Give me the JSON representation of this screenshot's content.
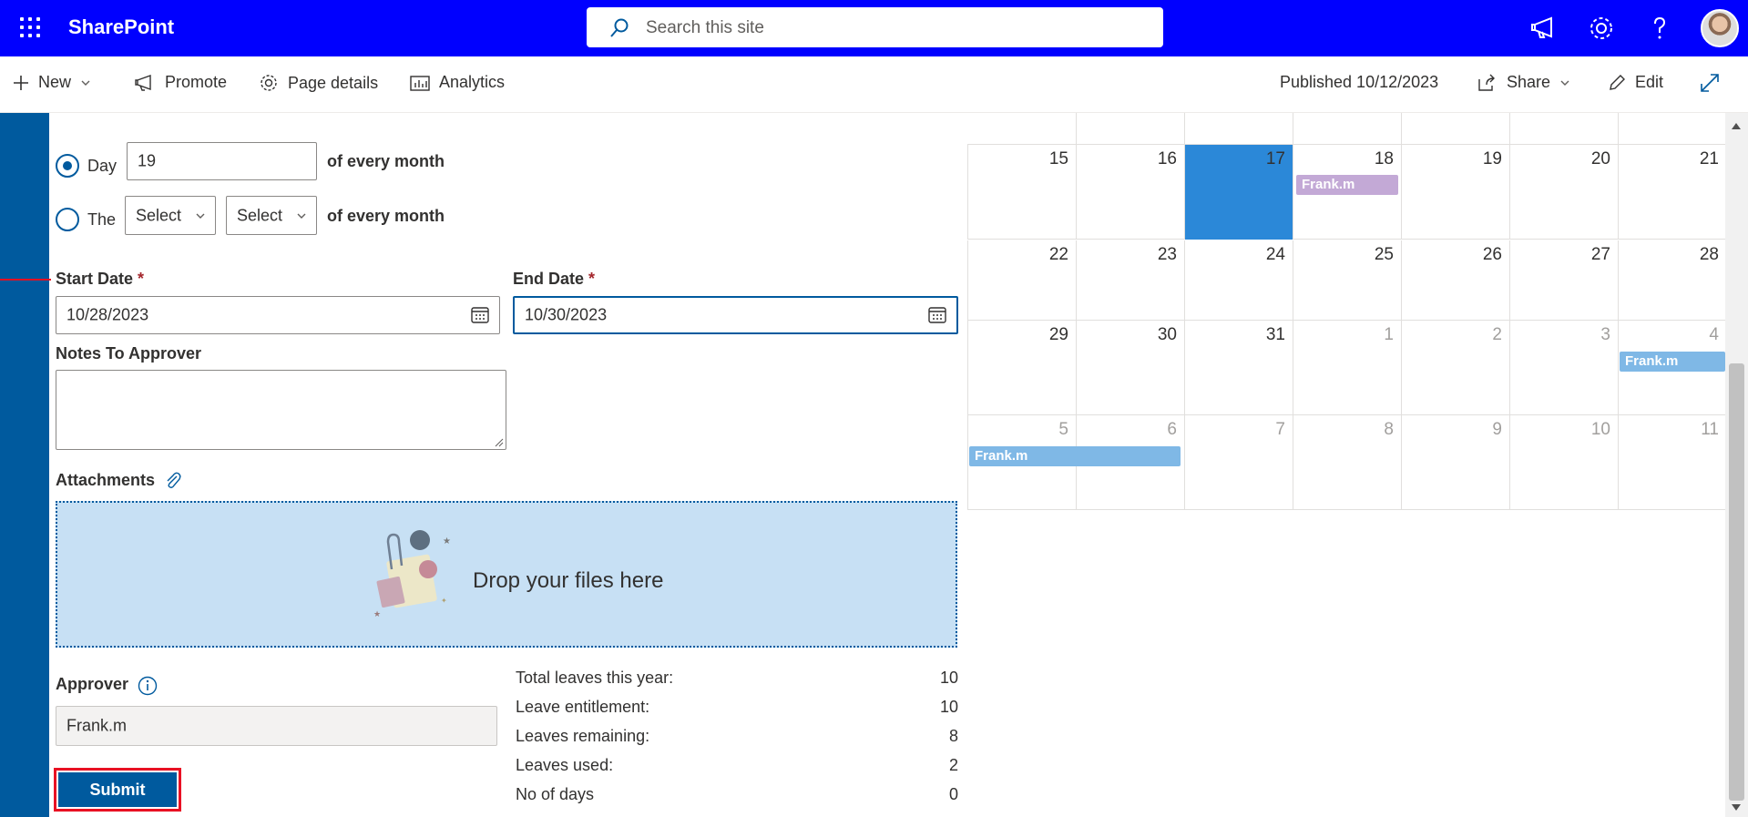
{
  "suitebar": {
    "app_name": "SharePoint",
    "search_placeholder": "Search this site",
    "icons": [
      "waffle-icon",
      "megaphone-icon",
      "gear-icon",
      "help-icon",
      "avatar"
    ]
  },
  "commandbar": {
    "new_label": "New",
    "promote_label": "Promote",
    "page_details_label": "Page details",
    "analytics_label": "Analytics",
    "published_label": "Published 10/12/2023",
    "share_label": "Share",
    "edit_label": "Edit"
  },
  "form": {
    "recurrence": {
      "option_day_label": "Day",
      "day_value": "19",
      "of_every_month_1": "of every month",
      "option_the_label": "The",
      "select_1": "Select",
      "select_2": "Select",
      "of_every_month_2": "of every month",
      "selected_option": "Day"
    },
    "start_date_label": "Start Date",
    "start_date_value": "10/28/2023",
    "end_date_label": "End Date",
    "end_date_value": "10/30/2023",
    "required_mark": "*",
    "notes_label": "Notes To Approver",
    "notes_value": "",
    "attachments_label": "Attachments",
    "dropzone_text": "Drop your files here",
    "approver_label": "Approver",
    "approver_value": "Frank.m",
    "submit_label": "Submit"
  },
  "stats": [
    {
      "label": "Total leaves this year:",
      "value": "10"
    },
    {
      "label": "Leave entitlement:",
      "value": "10"
    },
    {
      "label": "Leaves remaining:",
      "value": "8"
    },
    {
      "label": "Leaves used:",
      "value": "2"
    },
    {
      "label": "No of days",
      "value": "0"
    }
  ],
  "calendar": {
    "weeks": [
      [
        "15",
        "16",
        "17",
        "18",
        "19",
        "20",
        "21"
      ],
      [
        "22",
        "23",
        "24",
        "25",
        "26",
        "27",
        "28"
      ],
      [
        "29",
        "30",
        "31",
        "1",
        "2",
        "3",
        "4"
      ],
      [
        "5",
        "6",
        "7",
        "8",
        "9",
        "10",
        "11"
      ]
    ],
    "today": "17",
    "events": [
      {
        "label": "Frank.m",
        "color": "#c3a9d6"
      },
      {
        "label": "Frank.m",
        "color": "#7fb8e6"
      },
      {
        "label": "Frank.m",
        "color": "#7fb8e6"
      }
    ]
  },
  "colors": {
    "suitebar": "#0000ff",
    "theme": "#005a9e",
    "dropzone": "#c7e0f4",
    "highlight_border": "#e81123",
    "today": "#2b88d8"
  }
}
